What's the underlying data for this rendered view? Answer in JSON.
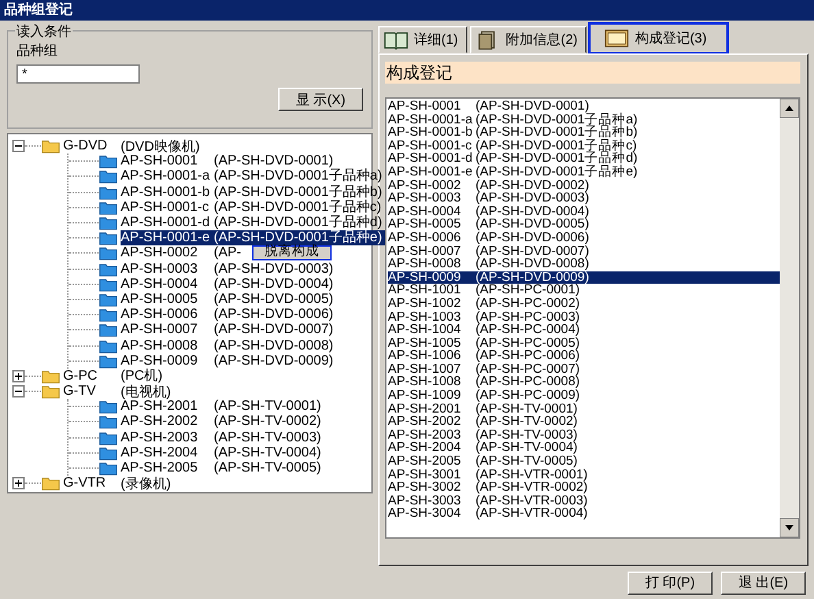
{
  "window": {
    "title": "品种组登记"
  },
  "filter": {
    "legend": "读入条件",
    "label": "品种组",
    "value": "*",
    "button": "显 示(X)"
  },
  "tree": [
    {
      "code": "G-DVD",
      "name": "(DVD映像机)",
      "expanded": true,
      "children": [
        {
          "code": "AP-SH-0001",
          "name": "(AP-SH-DVD-0001)",
          "selected": false
        },
        {
          "code": "AP-SH-0001-a",
          "name": "(AP-SH-DVD-0001子品种a)",
          "selected": false
        },
        {
          "code": "AP-SH-0001-b",
          "name": "(AP-SH-DVD-0001子品种b)",
          "selected": false
        },
        {
          "code": "AP-SH-0001-c",
          "name": "(AP-SH-DVD-0001子品种c)",
          "selected": false
        },
        {
          "code": "AP-SH-0001-d",
          "name": "(AP-SH-DVD-0001子品种d)",
          "selected": false
        },
        {
          "code": "AP-SH-0001-e",
          "name": "(AP-SH-DVD-0001子品种e)",
          "selected": true
        },
        {
          "code": "AP-SH-0002",
          "name": "(AP-",
          "selected": false
        },
        {
          "code": "AP-SH-0003",
          "name": "(AP-SH-DVD-0003)",
          "selected": false
        },
        {
          "code": "AP-SH-0004",
          "name": "(AP-SH-DVD-0004)",
          "selected": false
        },
        {
          "code": "AP-SH-0005",
          "name": "(AP-SH-DVD-0005)",
          "selected": false
        },
        {
          "code": "AP-SH-0006",
          "name": "(AP-SH-DVD-0006)",
          "selected": false
        },
        {
          "code": "AP-SH-0007",
          "name": "(AP-SH-DVD-0007)",
          "selected": false
        },
        {
          "code": "AP-SH-0008",
          "name": "(AP-SH-DVD-0008)",
          "selected": false
        },
        {
          "code": "AP-SH-0009",
          "name": "(AP-SH-DVD-0009)",
          "selected": false
        }
      ]
    },
    {
      "code": "G-PC",
      "name": "(PC机)",
      "expanded": false
    },
    {
      "code": "G-TV",
      "name": "(电视机)",
      "expanded": true,
      "children": [
        {
          "code": "AP-SH-2001",
          "name": "(AP-SH-TV-0001)",
          "selected": false
        },
        {
          "code": "AP-SH-2002",
          "name": "(AP-SH-TV-0002)",
          "selected": false
        },
        {
          "code": "AP-SH-2003",
          "name": "(AP-SH-TV-0003)",
          "selected": false
        },
        {
          "code": "AP-SH-2004",
          "name": "(AP-SH-TV-0004)",
          "selected": false
        },
        {
          "code": "AP-SH-2005",
          "name": "(AP-SH-TV-0005)",
          "selected": false
        }
      ]
    },
    {
      "code": "G-VTR",
      "name": "(录像机)",
      "expanded": false
    }
  ],
  "context_menu": {
    "items": [
      "脱离构成"
    ]
  },
  "tabs": [
    {
      "label": "详细(1)",
      "kind": "book",
      "selected": false
    },
    {
      "label": "附加信息(2)",
      "kind": "files",
      "selected": false
    },
    {
      "label": "构成登记(3)",
      "kind": "screen",
      "selected": true
    }
  ],
  "section_title": "构成登记",
  "list": [
    {
      "code": "AP-SH-0001",
      "name": "(AP-SH-DVD-0001)",
      "selected": false
    },
    {
      "code": "AP-SH-0001-a",
      "name": "(AP-SH-DVD-0001子品种a)",
      "selected": false
    },
    {
      "code": "AP-SH-0001-b",
      "name": "(AP-SH-DVD-0001子品种b)",
      "selected": false
    },
    {
      "code": "AP-SH-0001-c",
      "name": "(AP-SH-DVD-0001子品种c)",
      "selected": false
    },
    {
      "code": "AP-SH-0001-d",
      "name": "(AP-SH-DVD-0001子品种d)",
      "selected": false
    },
    {
      "code": "AP-SH-0001-e",
      "name": "(AP-SH-DVD-0001子品种e)",
      "selected": false
    },
    {
      "code": "AP-SH-0002",
      "name": "(AP-SH-DVD-0002)",
      "selected": false
    },
    {
      "code": "AP-SH-0003",
      "name": "(AP-SH-DVD-0003)",
      "selected": false
    },
    {
      "code": "AP-SH-0004",
      "name": "(AP-SH-DVD-0004)",
      "selected": false
    },
    {
      "code": "AP-SH-0005",
      "name": "(AP-SH-DVD-0005)",
      "selected": false
    },
    {
      "code": "AP-SH-0006",
      "name": "(AP-SH-DVD-0006)",
      "selected": false
    },
    {
      "code": "AP-SH-0007",
      "name": "(AP-SH-DVD-0007)",
      "selected": false
    },
    {
      "code": "AP-SH-0008",
      "name": "(AP-SH-DVD-0008)",
      "selected": false
    },
    {
      "code": "AP-SH-0009",
      "name": "(AP-SH-DVD-0009)",
      "selected": true
    },
    {
      "code": "AP-SH-1001",
      "name": "(AP-SH-PC-0001)",
      "selected": false
    },
    {
      "code": "AP-SH-1002",
      "name": "(AP-SH-PC-0002)",
      "selected": false
    },
    {
      "code": "AP-SH-1003",
      "name": "(AP-SH-PC-0003)",
      "selected": false
    },
    {
      "code": "AP-SH-1004",
      "name": "(AP-SH-PC-0004)",
      "selected": false
    },
    {
      "code": "AP-SH-1005",
      "name": "(AP-SH-PC-0005)",
      "selected": false
    },
    {
      "code": "AP-SH-1006",
      "name": "(AP-SH-PC-0006)",
      "selected": false
    },
    {
      "code": "AP-SH-1007",
      "name": "(AP-SH-PC-0007)",
      "selected": false
    },
    {
      "code": "AP-SH-1008",
      "name": "(AP-SH-PC-0008)",
      "selected": false
    },
    {
      "code": "AP-SH-1009",
      "name": "(AP-SH-PC-0009)",
      "selected": false
    },
    {
      "code": "AP-SH-2001",
      "name": "(AP-SH-TV-0001)",
      "selected": false
    },
    {
      "code": "AP-SH-2002",
      "name": "(AP-SH-TV-0002)",
      "selected": false
    },
    {
      "code": "AP-SH-2003",
      "name": "(AP-SH-TV-0003)",
      "selected": false
    },
    {
      "code": "AP-SH-2004",
      "name": "(AP-SH-TV-0004)",
      "selected": false
    },
    {
      "code": "AP-SH-2005",
      "name": "(AP-SH-TV-0005)",
      "selected": false
    },
    {
      "code": "AP-SH-3001",
      "name": "(AP-SH-VTR-0001)",
      "selected": false
    },
    {
      "code": "AP-SH-3002",
      "name": "(AP-SH-VTR-0002)",
      "selected": false
    },
    {
      "code": "AP-SH-3003",
      "name": "(AP-SH-VTR-0003)",
      "selected": false
    },
    {
      "code": "AP-SH-3004",
      "name": "(AP-SH-VTR-0004)",
      "selected": false
    }
  ],
  "buttons": [
    "打 印(P)",
    "退 出(E)"
  ]
}
